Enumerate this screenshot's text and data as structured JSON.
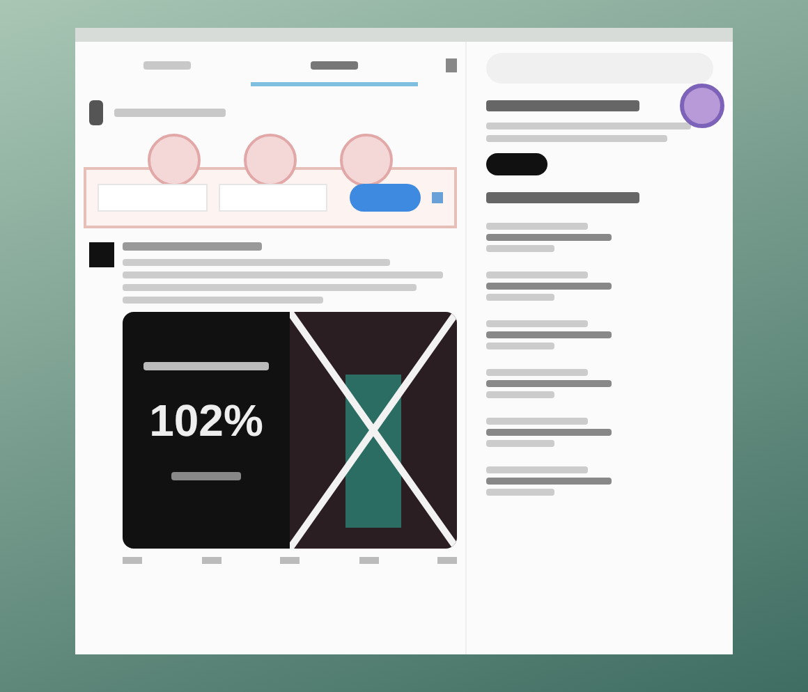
{
  "tabs": [
    {
      "selected": false
    },
    {
      "selected": true
    }
  ],
  "post": {
    "image_stat": "102%"
  }
}
